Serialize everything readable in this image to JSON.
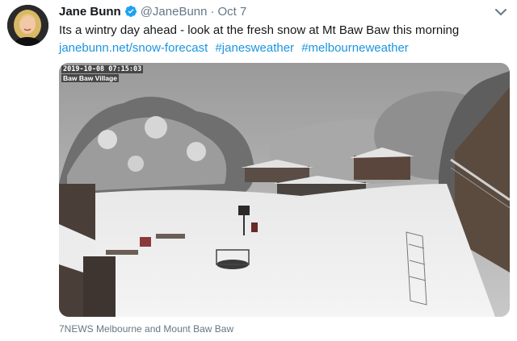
{
  "author": {
    "name": "Jane Bunn",
    "handle": "@JaneBunn",
    "separator": "·",
    "time": "Oct 7"
  },
  "tweet": {
    "text": "Its a wintry day ahead - look at the fresh snow at Mt Baw Baw this morning",
    "link": "janebunn.net/snow-forecast",
    "hashtags": [
      "#janesweather",
      "#melbourneweather"
    ]
  },
  "media": {
    "timestamp": "2019-10-08 07:15:03",
    "location_label": "Baw Baw Village",
    "caption": "7NEWS Melbourne and Mount Baw Baw"
  },
  "icons": {
    "verified": "verified-badge-icon",
    "menu": "chevron-down-icon"
  },
  "colors": {
    "link": "#1b95e0",
    "verified": "#1da1f2",
    "secondary_text": "#657786"
  }
}
